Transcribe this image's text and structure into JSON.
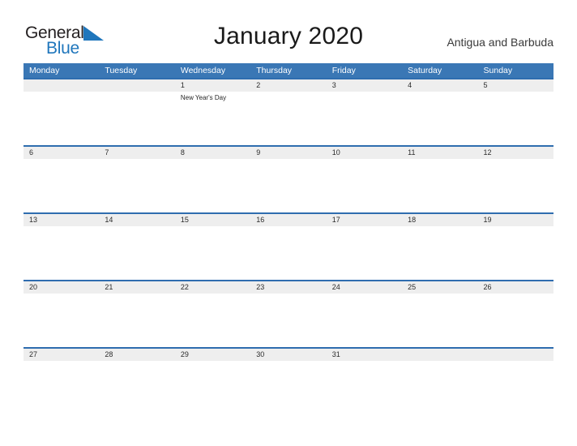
{
  "brand": {
    "name_part1": "General",
    "name_part2": "Blue",
    "flag_icon": "blue-triangle-flag-icon",
    "color_dark": "#231f20",
    "color_blue": "#1f76bc"
  },
  "header": {
    "title": "January 2020",
    "locale": "Antigua and Barbuda"
  },
  "calendar": {
    "accent_color": "#3a77b5",
    "row_border_color": "#2f6daf",
    "date_band_color": "#eeeeee",
    "weekday_headers": [
      "Monday",
      "Tuesday",
      "Wednesday",
      "Thursday",
      "Friday",
      "Saturday",
      "Sunday"
    ],
    "weeks": [
      {
        "days": [
          {
            "date": "",
            "events": []
          },
          {
            "date": "",
            "events": []
          },
          {
            "date": "1",
            "events": [
              "New Year's Day"
            ]
          },
          {
            "date": "2",
            "events": []
          },
          {
            "date": "3",
            "events": []
          },
          {
            "date": "4",
            "events": []
          },
          {
            "date": "5",
            "events": []
          }
        ]
      },
      {
        "days": [
          {
            "date": "6",
            "events": []
          },
          {
            "date": "7",
            "events": []
          },
          {
            "date": "8",
            "events": []
          },
          {
            "date": "9",
            "events": []
          },
          {
            "date": "10",
            "events": []
          },
          {
            "date": "11",
            "events": []
          },
          {
            "date": "12",
            "events": []
          }
        ]
      },
      {
        "days": [
          {
            "date": "13",
            "events": []
          },
          {
            "date": "14",
            "events": []
          },
          {
            "date": "15",
            "events": []
          },
          {
            "date": "16",
            "events": []
          },
          {
            "date": "17",
            "events": []
          },
          {
            "date": "18",
            "events": []
          },
          {
            "date": "19",
            "events": []
          }
        ]
      },
      {
        "days": [
          {
            "date": "20",
            "events": []
          },
          {
            "date": "21",
            "events": []
          },
          {
            "date": "22",
            "events": []
          },
          {
            "date": "23",
            "events": []
          },
          {
            "date": "24",
            "events": []
          },
          {
            "date": "25",
            "events": []
          },
          {
            "date": "26",
            "events": []
          }
        ]
      },
      {
        "days": [
          {
            "date": "27",
            "events": []
          },
          {
            "date": "28",
            "events": []
          },
          {
            "date": "29",
            "events": []
          },
          {
            "date": "30",
            "events": []
          },
          {
            "date": "31",
            "events": []
          },
          {
            "date": "",
            "events": []
          },
          {
            "date": "",
            "events": []
          }
        ]
      }
    ]
  }
}
